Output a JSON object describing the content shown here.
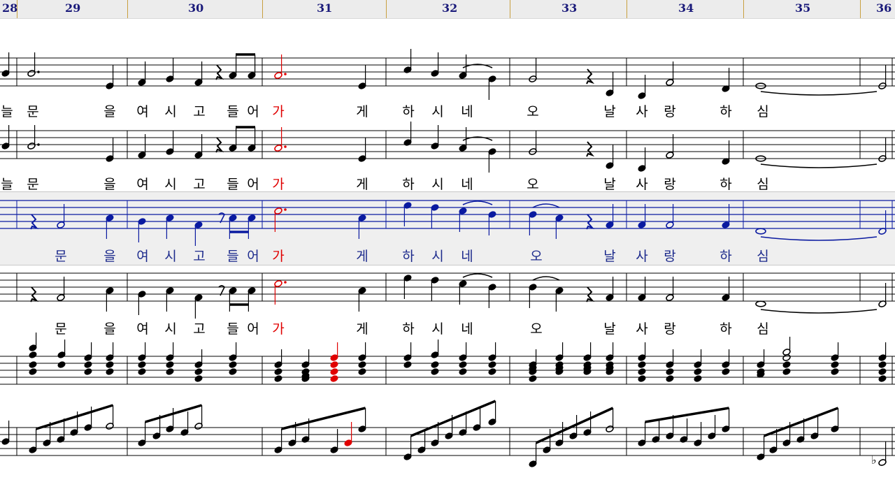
{
  "ruler": {
    "measures": [
      "28",
      "29",
      "30",
      "31",
      "32",
      "33",
      "34",
      "35",
      "36"
    ]
  },
  "lyrics": {
    "line1": [
      "늘",
      "문",
      "을",
      "여",
      "시",
      "고",
      "들",
      "어",
      "가",
      "게",
      "하",
      "시",
      "네",
      "오",
      "날",
      "사",
      "랑",
      "하",
      "심"
    ],
    "line2": [
      "늘",
      "문",
      "을",
      "여",
      "시",
      "고",
      "들",
      "어",
      "가",
      "게",
      "하",
      "시",
      "네",
      "오",
      "날",
      "사",
      "랑",
      "하",
      "심"
    ],
    "line3": [
      "문",
      "을",
      "여",
      "시",
      "고",
      "들",
      "어",
      "가",
      "게",
      "하",
      "시",
      "네",
      "오",
      "날",
      "사",
      "랑",
      "하",
      "심"
    ],
    "line4": [
      "문",
      "을",
      "여",
      "시",
      "고",
      "들",
      "어",
      "가",
      "게",
      "하",
      "시",
      "네",
      "오",
      "날",
      "사",
      "랑",
      "하",
      "심"
    ]
  },
  "colors": {
    "default_ink": "#000000",
    "current_note": "#e00000",
    "active_staff": "#0a1aa0",
    "active_lyrics": "#1c2a8c",
    "ruler_numbers": "#1a1a7a",
    "highlight_background": "#efefef"
  },
  "state": {
    "current_measure": "31",
    "current_syllable": "가",
    "active_part": "alto"
  }
}
